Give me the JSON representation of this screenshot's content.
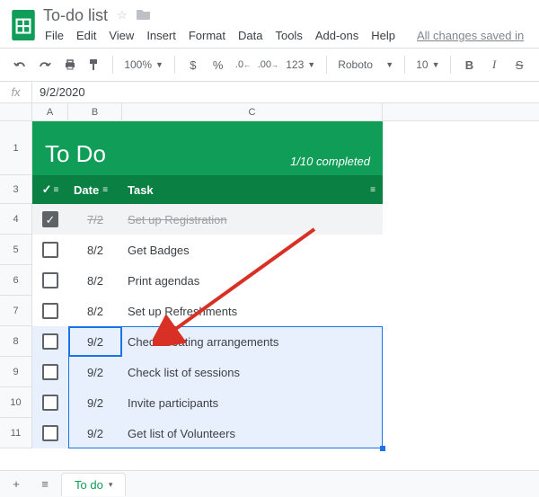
{
  "doc": {
    "title": "To-do list",
    "saved_status": "All changes saved in"
  },
  "menu": {
    "file": "File",
    "edit": "Edit",
    "view": "View",
    "insert": "Insert",
    "format": "Format",
    "data": "Data",
    "tools": "Tools",
    "addons": "Add-ons",
    "help": "Help"
  },
  "toolbar": {
    "zoom": "100%",
    "currency": "$",
    "percent": "%",
    "dec_dec": ".0",
    "inc_dec": ".00",
    "numfmt": "123",
    "font": "Roboto",
    "fontsize": "10",
    "bold": "B",
    "italic": "I",
    "strike": "S"
  },
  "formula": {
    "fx": "fx",
    "value": "9/2/2020"
  },
  "columns": {
    "a": "A",
    "b": "B",
    "c": "C"
  },
  "row_numbers": [
    "1",
    "3",
    "4",
    "5",
    "6",
    "7",
    "8",
    "9",
    "10",
    "11"
  ],
  "todo": {
    "title": "To Do",
    "completed": "1/10 completed",
    "check_icon": "✓",
    "col_date": "Date",
    "col_task": "Task"
  },
  "tasks": [
    {
      "done": true,
      "date": "7/2",
      "task": "Set up Registration"
    },
    {
      "done": false,
      "date": "8/2",
      "task": "Get Badges"
    },
    {
      "done": false,
      "date": "8/2",
      "task": "Print agendas"
    },
    {
      "done": false,
      "date": "8/2",
      "task": "Set up Refreshments"
    },
    {
      "done": false,
      "date": "9/2",
      "task": "Check Seating arrangements"
    },
    {
      "done": false,
      "date": "9/2",
      "task": "Check list of sessions"
    },
    {
      "done": false,
      "date": "9/2",
      "task": "Invite participants"
    },
    {
      "done": false,
      "date": "9/2",
      "task": "Get list of Volunteers"
    }
  ],
  "sheet": {
    "add": "+",
    "all": "≡",
    "name": "To do",
    "menu": "▾"
  }
}
